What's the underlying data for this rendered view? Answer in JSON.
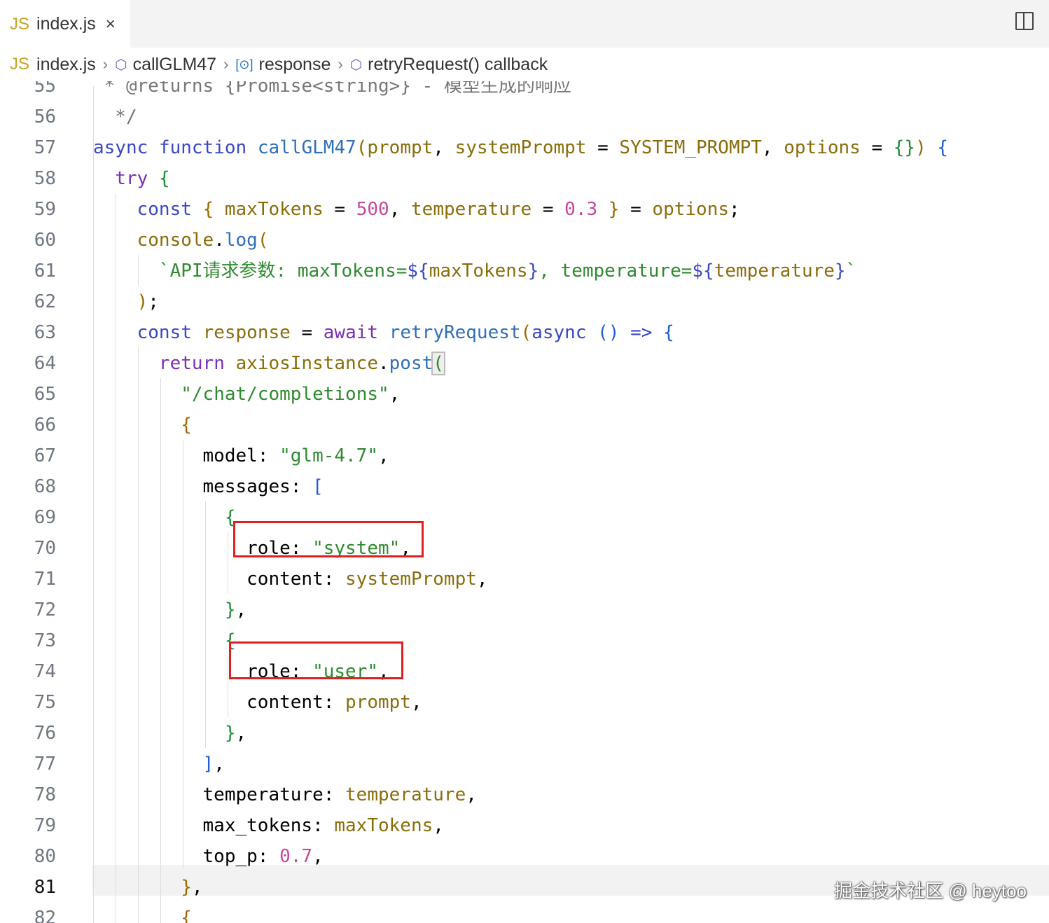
{
  "tab": {
    "js_label": "JS",
    "title": "index.js",
    "close": "×"
  },
  "breadcrumb": {
    "file": "index.js",
    "fn": "callGLM47",
    "var": "response",
    "cb": "retryRequest() callback"
  },
  "code_lines": [
    {
      "n": "55",
      "cur": false,
      "html": "<span class=\"cm\"> * @returns {Promise&lt;string&gt;} - 模型生成的响应</span>"
    },
    {
      "n": "56",
      "cur": false,
      "html": "<span class=\"cm\">  */</span>"
    },
    {
      "n": "57",
      "cur": false,
      "html": "<span class=\"k2\">async</span> <span class=\"k2\">function</span> <span class=\"fn\">callGLM47</span><span class=\"b3\">(</span><span class=\"p\">prompt</span>, <span class=\"p\">systemPrompt</span> = <span class=\"p\">SYSTEM_PROMPT</span>, <span class=\"p\">options</span> = <span class=\"b2\">{}</span><span class=\"b3\">)</span> <span class=\"b1\">{</span>"
    },
    {
      "n": "58",
      "cur": false,
      "html": "  <span class=\"k\">try</span> <span class=\"b2\">{</span>"
    },
    {
      "n": "59",
      "cur": false,
      "html": "    <span class=\"k2\">const</span> <span class=\"b3\">{</span> <span class=\"p\">maxTokens</span> = <span class=\"n\">500</span>, <span class=\"p\">temperature</span> = <span class=\"n\">0.3</span> <span class=\"b3\">}</span> = <span class=\"p\">options</span>;"
    },
    {
      "n": "60",
      "cur": false,
      "html": "    <span class=\"p\">console</span>.<span class=\"fn\">log</span><span class=\"b3\">(</span>"
    },
    {
      "n": "61",
      "cur": false,
      "html": "      <span class=\"s\">`API请求参数: maxTokens=</span><span class=\"k2\">${</span><span class=\"p\">maxTokens</span><span class=\"k2\">}</span><span class=\"s\">, temperature=</span><span class=\"k2\">${</span><span class=\"p\">temperature</span><span class=\"k2\">}</span><span class=\"s\">`</span>"
    },
    {
      "n": "62",
      "cur": false,
      "html": "    <span class=\"b3\">)</span>;"
    },
    {
      "n": "63",
      "cur": false,
      "html": "    <span class=\"k2\">const</span> <span class=\"p\">response</span> = <span class=\"k\">await</span> <span class=\"fn\">retryRequest</span><span class=\"b3\">(</span><span class=\"k2\">async</span> <span class=\"b1\">()</span> <span class=\"k2\">=&gt;</span> <span class=\"b1\">{</span>"
    },
    {
      "n": "64",
      "cur": false,
      "html": "      <span class=\"k\">return</span> <span class=\"p\">axiosInstance</span>.<span class=\"fn\">post</span><span class=\"gl\" style=\"outline:2px solid #bbb;background:#eee;\">(</span>"
    },
    {
      "n": "65",
      "cur": false,
      "html": "        <span class=\"s\">\"/chat/completions\"</span>,"
    },
    {
      "n": "66",
      "cur": false,
      "html": "        <span class=\"b3\">{</span>"
    },
    {
      "n": "67",
      "cur": false,
      "html": "          model: <span class=\"s\">\"glm-4.7\"</span>,"
    },
    {
      "n": "68",
      "cur": false,
      "html": "          messages: <span class=\"b1\">[</span>"
    },
    {
      "n": "69",
      "cur": false,
      "html": "            <span class=\"b2\">{</span>"
    },
    {
      "n": "70",
      "cur": false,
      "html": "              role: <span class=\"s\">\"system\"</span>,"
    },
    {
      "n": "71",
      "cur": false,
      "html": "              content: <span class=\"p\">systemPrompt</span>,"
    },
    {
      "n": "72",
      "cur": false,
      "html": "            <span class=\"b2\">}</span>,"
    },
    {
      "n": "73",
      "cur": false,
      "html": "            <span class=\"b2\">{</span>"
    },
    {
      "n": "74",
      "cur": false,
      "html": "              role: <span class=\"s\">\"user\"</span>,"
    },
    {
      "n": "75",
      "cur": false,
      "html": "              content: <span class=\"p\">prompt</span>,"
    },
    {
      "n": "76",
      "cur": false,
      "html": "            <span class=\"b2\">}</span>,"
    },
    {
      "n": "77",
      "cur": false,
      "html": "          <span class=\"b1\">]</span>,"
    },
    {
      "n": "78",
      "cur": false,
      "html": "          temperature: <span class=\"p\">temperature</span>,"
    },
    {
      "n": "79",
      "cur": false,
      "html": "          max_tokens: <span class=\"p\">maxTokens</span>,"
    },
    {
      "n": "80",
      "cur": false,
      "html": "          top_p: <span class=\"n\">0.7</span>,"
    },
    {
      "n": "81",
      "cur": true,
      "html": "        <span class=\"b3\">}</span>,"
    },
    {
      "n": "82",
      "cur": false,
      "html": "        <span class=\"b3\">{</span>"
    }
  ],
  "watermark": "掘金技术社区 @ heytoo"
}
